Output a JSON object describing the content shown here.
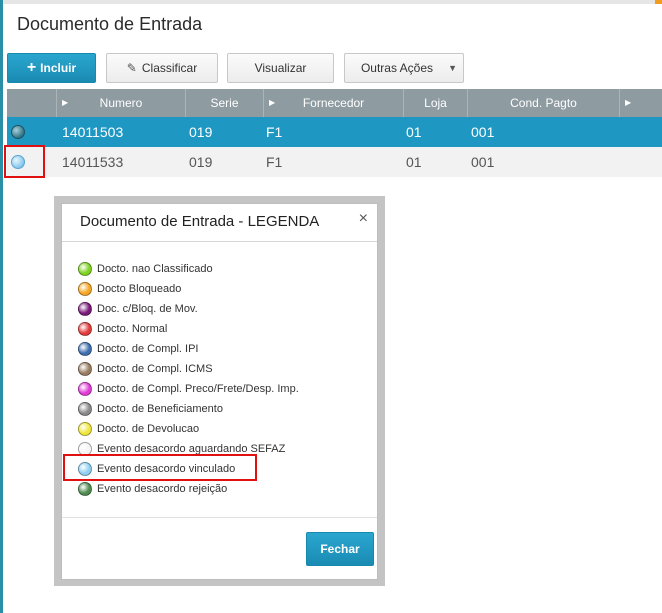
{
  "page": {
    "title": "Documento de Entrada"
  },
  "toolbar": {
    "incluir_label": "Incluir",
    "classificar_label": "Classificar",
    "visualizar_label": "Visualizar",
    "outras_label": "Outras Ações"
  },
  "grid": {
    "columns": [
      "Numero",
      "Serie",
      "Fornecedor",
      "Loja",
      "Cond. Pagto"
    ],
    "rows": [
      {
        "numero": "14011503",
        "serie": "019",
        "fornecedor": "F1",
        "loja": "01",
        "cond": "001"
      },
      {
        "numero": "14011533",
        "serie": "019",
        "fornecedor": "F1",
        "loja": "01",
        "cond": "001"
      }
    ]
  },
  "dialog": {
    "title": "Documento de Entrada - LEGENDA",
    "close_symbol": "×",
    "button_label": "Fechar",
    "items": [
      {
        "label": "Docto. nao Classificado",
        "color": "#7ed321"
      },
      {
        "label": "Docto Bloqueado",
        "color": "#f5a623"
      },
      {
        "label": "Doc. c/Bloq. de Mov.",
        "color": "#7a1a7a"
      },
      {
        "label": "Docto. Normal",
        "color": "#e23b3b"
      },
      {
        "label": "Docto. de Compl. IPI",
        "color": "#3f6fae"
      },
      {
        "label": "Docto. de Compl. ICMS",
        "color": "#9a7d61"
      },
      {
        "label": "Docto. de Compl. Preco/Frete/Desp. Imp.",
        "color": "#e03cd6"
      },
      {
        "label": "Docto. de Beneficiamento",
        "color": "#8a8a8a"
      },
      {
        "label": "Docto. de Devolucao",
        "color": "#efe63c"
      },
      {
        "label": "Evento desacordo aguardando SEFAZ",
        "color": "#f4f4f4"
      },
      {
        "label": "Evento desacordo vinculado",
        "color": "#8fd0f2"
      },
      {
        "label": "Evento desacordo rejeição",
        "color": "#4f8a4f"
      }
    ]
  },
  "colors": {
    "accent": "#1e97c2",
    "highlight": "#e01010",
    "header": "#8e9ba1"
  }
}
